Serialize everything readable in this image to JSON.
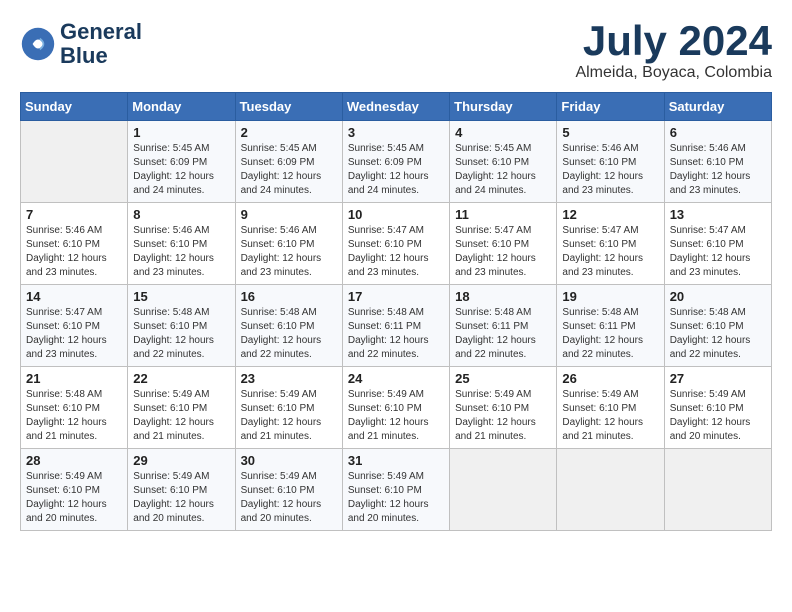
{
  "logo": {
    "line1": "General",
    "line2": "Blue"
  },
  "title": "July 2024",
  "location": "Almeida, Boyaca, Colombia",
  "days_of_week": [
    "Sunday",
    "Monday",
    "Tuesday",
    "Wednesday",
    "Thursday",
    "Friday",
    "Saturday"
  ],
  "weeks": [
    [
      {
        "day": "",
        "sunrise": "",
        "sunset": "",
        "daylight": ""
      },
      {
        "day": "1",
        "sunrise": "Sunrise: 5:45 AM",
        "sunset": "Sunset: 6:09 PM",
        "daylight": "Daylight: 12 hours and 24 minutes."
      },
      {
        "day": "2",
        "sunrise": "Sunrise: 5:45 AM",
        "sunset": "Sunset: 6:09 PM",
        "daylight": "Daylight: 12 hours and 24 minutes."
      },
      {
        "day": "3",
        "sunrise": "Sunrise: 5:45 AM",
        "sunset": "Sunset: 6:09 PM",
        "daylight": "Daylight: 12 hours and 24 minutes."
      },
      {
        "day": "4",
        "sunrise": "Sunrise: 5:45 AM",
        "sunset": "Sunset: 6:10 PM",
        "daylight": "Daylight: 12 hours and 24 minutes."
      },
      {
        "day": "5",
        "sunrise": "Sunrise: 5:46 AM",
        "sunset": "Sunset: 6:10 PM",
        "daylight": "Daylight: 12 hours and 23 minutes."
      },
      {
        "day": "6",
        "sunrise": "Sunrise: 5:46 AM",
        "sunset": "Sunset: 6:10 PM",
        "daylight": "Daylight: 12 hours and 23 minutes."
      }
    ],
    [
      {
        "day": "7",
        "sunrise": "Sunrise: 5:46 AM",
        "sunset": "Sunset: 6:10 PM",
        "daylight": "Daylight: 12 hours and 23 minutes."
      },
      {
        "day": "8",
        "sunrise": "Sunrise: 5:46 AM",
        "sunset": "Sunset: 6:10 PM",
        "daylight": "Daylight: 12 hours and 23 minutes."
      },
      {
        "day": "9",
        "sunrise": "Sunrise: 5:46 AM",
        "sunset": "Sunset: 6:10 PM",
        "daylight": "Daylight: 12 hours and 23 minutes."
      },
      {
        "day": "10",
        "sunrise": "Sunrise: 5:47 AM",
        "sunset": "Sunset: 6:10 PM",
        "daylight": "Daylight: 12 hours and 23 minutes."
      },
      {
        "day": "11",
        "sunrise": "Sunrise: 5:47 AM",
        "sunset": "Sunset: 6:10 PM",
        "daylight": "Daylight: 12 hours and 23 minutes."
      },
      {
        "day": "12",
        "sunrise": "Sunrise: 5:47 AM",
        "sunset": "Sunset: 6:10 PM",
        "daylight": "Daylight: 12 hours and 23 minutes."
      },
      {
        "day": "13",
        "sunrise": "Sunrise: 5:47 AM",
        "sunset": "Sunset: 6:10 PM",
        "daylight": "Daylight: 12 hours and 23 minutes."
      }
    ],
    [
      {
        "day": "14",
        "sunrise": "Sunrise: 5:47 AM",
        "sunset": "Sunset: 6:10 PM",
        "daylight": "Daylight: 12 hours and 23 minutes."
      },
      {
        "day": "15",
        "sunrise": "Sunrise: 5:48 AM",
        "sunset": "Sunset: 6:10 PM",
        "daylight": "Daylight: 12 hours and 22 minutes."
      },
      {
        "day": "16",
        "sunrise": "Sunrise: 5:48 AM",
        "sunset": "Sunset: 6:10 PM",
        "daylight": "Daylight: 12 hours and 22 minutes."
      },
      {
        "day": "17",
        "sunrise": "Sunrise: 5:48 AM",
        "sunset": "Sunset: 6:11 PM",
        "daylight": "Daylight: 12 hours and 22 minutes."
      },
      {
        "day": "18",
        "sunrise": "Sunrise: 5:48 AM",
        "sunset": "Sunset: 6:11 PM",
        "daylight": "Daylight: 12 hours and 22 minutes."
      },
      {
        "day": "19",
        "sunrise": "Sunrise: 5:48 AM",
        "sunset": "Sunset: 6:11 PM",
        "daylight": "Daylight: 12 hours and 22 minutes."
      },
      {
        "day": "20",
        "sunrise": "Sunrise: 5:48 AM",
        "sunset": "Sunset: 6:10 PM",
        "daylight": "Daylight: 12 hours and 22 minutes."
      }
    ],
    [
      {
        "day": "21",
        "sunrise": "Sunrise: 5:48 AM",
        "sunset": "Sunset: 6:10 PM",
        "daylight": "Daylight: 12 hours and 21 minutes."
      },
      {
        "day": "22",
        "sunrise": "Sunrise: 5:49 AM",
        "sunset": "Sunset: 6:10 PM",
        "daylight": "Daylight: 12 hours and 21 minutes."
      },
      {
        "day": "23",
        "sunrise": "Sunrise: 5:49 AM",
        "sunset": "Sunset: 6:10 PM",
        "daylight": "Daylight: 12 hours and 21 minutes."
      },
      {
        "day": "24",
        "sunrise": "Sunrise: 5:49 AM",
        "sunset": "Sunset: 6:10 PM",
        "daylight": "Daylight: 12 hours and 21 minutes."
      },
      {
        "day": "25",
        "sunrise": "Sunrise: 5:49 AM",
        "sunset": "Sunset: 6:10 PM",
        "daylight": "Daylight: 12 hours and 21 minutes."
      },
      {
        "day": "26",
        "sunrise": "Sunrise: 5:49 AM",
        "sunset": "Sunset: 6:10 PM",
        "daylight": "Daylight: 12 hours and 21 minutes."
      },
      {
        "day": "27",
        "sunrise": "Sunrise: 5:49 AM",
        "sunset": "Sunset: 6:10 PM",
        "daylight": "Daylight: 12 hours and 20 minutes."
      }
    ],
    [
      {
        "day": "28",
        "sunrise": "Sunrise: 5:49 AM",
        "sunset": "Sunset: 6:10 PM",
        "daylight": "Daylight: 12 hours and 20 minutes."
      },
      {
        "day": "29",
        "sunrise": "Sunrise: 5:49 AM",
        "sunset": "Sunset: 6:10 PM",
        "daylight": "Daylight: 12 hours and 20 minutes."
      },
      {
        "day": "30",
        "sunrise": "Sunrise: 5:49 AM",
        "sunset": "Sunset: 6:10 PM",
        "daylight": "Daylight: 12 hours and 20 minutes."
      },
      {
        "day": "31",
        "sunrise": "Sunrise: 5:49 AM",
        "sunset": "Sunset: 6:10 PM",
        "daylight": "Daylight: 12 hours and 20 minutes."
      },
      {
        "day": "",
        "sunrise": "",
        "sunset": "",
        "daylight": ""
      },
      {
        "day": "",
        "sunrise": "",
        "sunset": "",
        "daylight": ""
      },
      {
        "day": "",
        "sunrise": "",
        "sunset": "",
        "daylight": ""
      }
    ]
  ]
}
